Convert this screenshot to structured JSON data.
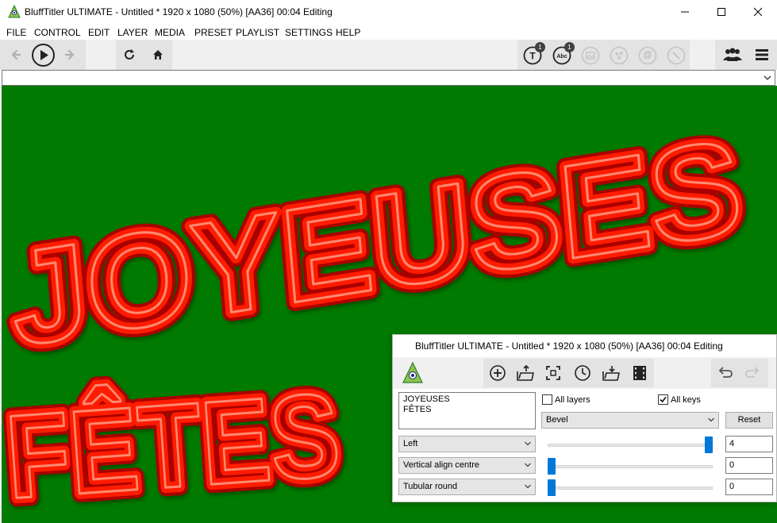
{
  "window": {
    "title": "BluffTitler ULTIMATE  - Untitled * 1920 x 1080 (50%) [AA36] 00:04 Editing"
  },
  "menu": {
    "items": [
      "FILE",
      "CONTROL",
      "EDIT",
      "LAYER",
      "MEDIA",
      "PRESET",
      "PLAYLIST",
      "SETTINGS",
      "HELP"
    ]
  },
  "toolbar": {
    "text_layers_badge": "1",
    "abc_layers_badge": "1",
    "abc_label": "Abc",
    "text_label": "T"
  },
  "canvas": {
    "background": "#007a00",
    "text_color": "#ff1a00",
    "line1": "JOYEUSES",
    "line2": "FÊTES"
  },
  "panel": {
    "title": "BluffTitler ULTIMATE  - Untitled * 1920 x 1080 (50%) [AA36] 00:04 Editing",
    "text_content_line1": "JOYEUSES",
    "text_content_line2": "FÊTES",
    "all_layers_label": "All layers",
    "all_layers_checked": false,
    "all_keys_label": "All keys",
    "all_keys_checked": true,
    "property_select": "Bevel",
    "reset_label": "Reset",
    "rows": [
      {
        "select": "Left",
        "value": "4",
        "slider_fraction": 1.0
      },
      {
        "select": "Vertical align centre",
        "value": "0",
        "slider_fraction": 0.0
      },
      {
        "select": "Tubular round",
        "value": "0",
        "slider_fraction": 0.0
      }
    ]
  },
  "colors": {
    "accent": "#0078d7",
    "toolbar_bg": "#f0f0f0",
    "group_bg": "#e3e3e3"
  }
}
